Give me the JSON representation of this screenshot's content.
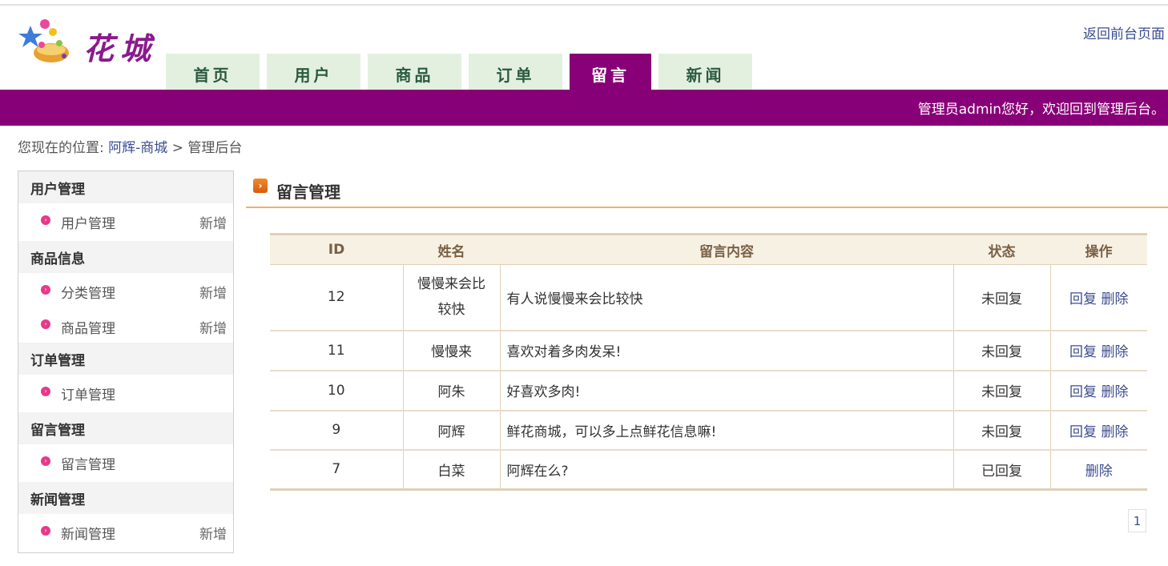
{
  "header": {
    "logo_text": "花城",
    "back_link": "返回前台页面",
    "welcome": "管理员admin您好，欢迎回到管理后台。"
  },
  "nav": {
    "tabs": [
      {
        "label": "首页"
      },
      {
        "label": "用户"
      },
      {
        "label": "商品"
      },
      {
        "label": "订单"
      },
      {
        "label": "留言",
        "active": true
      },
      {
        "label": "新闻"
      }
    ]
  },
  "breadcrumb": {
    "prefix": "您现在的位置:",
    "home_link": "阿辉-商城",
    "separator": ">",
    "current": "管理后台"
  },
  "sidebar": {
    "groups": [
      {
        "title": "用户管理",
        "items": [
          {
            "label": "用户管理",
            "add": "新增"
          }
        ]
      },
      {
        "title": "商品信息",
        "items": [
          {
            "label": "分类管理",
            "add": "新增"
          },
          {
            "label": "商品管理",
            "add": "新增"
          }
        ]
      },
      {
        "title": "订单管理",
        "items": [
          {
            "label": "订单管理",
            "add": ""
          }
        ]
      },
      {
        "title": "留言管理",
        "items": [
          {
            "label": "留言管理",
            "add": ""
          }
        ]
      },
      {
        "title": "新闻管理",
        "items": [
          {
            "label": "新闻管理",
            "add": "新增"
          }
        ]
      }
    ]
  },
  "main": {
    "title": "留言管理",
    "table": {
      "headers": {
        "id": "ID",
        "name": "姓名",
        "content": "留言内容",
        "status": "状态",
        "action": "操作"
      },
      "rows": [
        {
          "id": "12",
          "name": "慢慢来会比较快",
          "content": "有人说慢慢来会比较快",
          "status": "未回复",
          "reply": "回复",
          "delete": "删除"
        },
        {
          "id": "11",
          "name": "慢慢来",
          "content": "喜欢对着多肉发呆!",
          "status": "未回复",
          "reply": "回复",
          "delete": "删除"
        },
        {
          "id": "10",
          "name": "阿朱",
          "content": "好喜欢多肉!",
          "status": "未回复",
          "reply": "回复",
          "delete": "删除"
        },
        {
          "id": "9",
          "name": "阿辉",
          "content": "鲜花商城，可以多上点鲜花信息嘛!",
          "status": "未回复",
          "reply": "回复",
          "delete": "删除"
        },
        {
          "id": "7",
          "name": "白菜",
          "content": "阿辉在么?",
          "status": "已回复",
          "reply": "",
          "delete": "删除"
        }
      ]
    },
    "pager": {
      "current_page": "1"
    }
  },
  "colors": {
    "brand": "#880077",
    "tab_bg": "#e3f0e0",
    "accent_line": "#f0b06a"
  }
}
